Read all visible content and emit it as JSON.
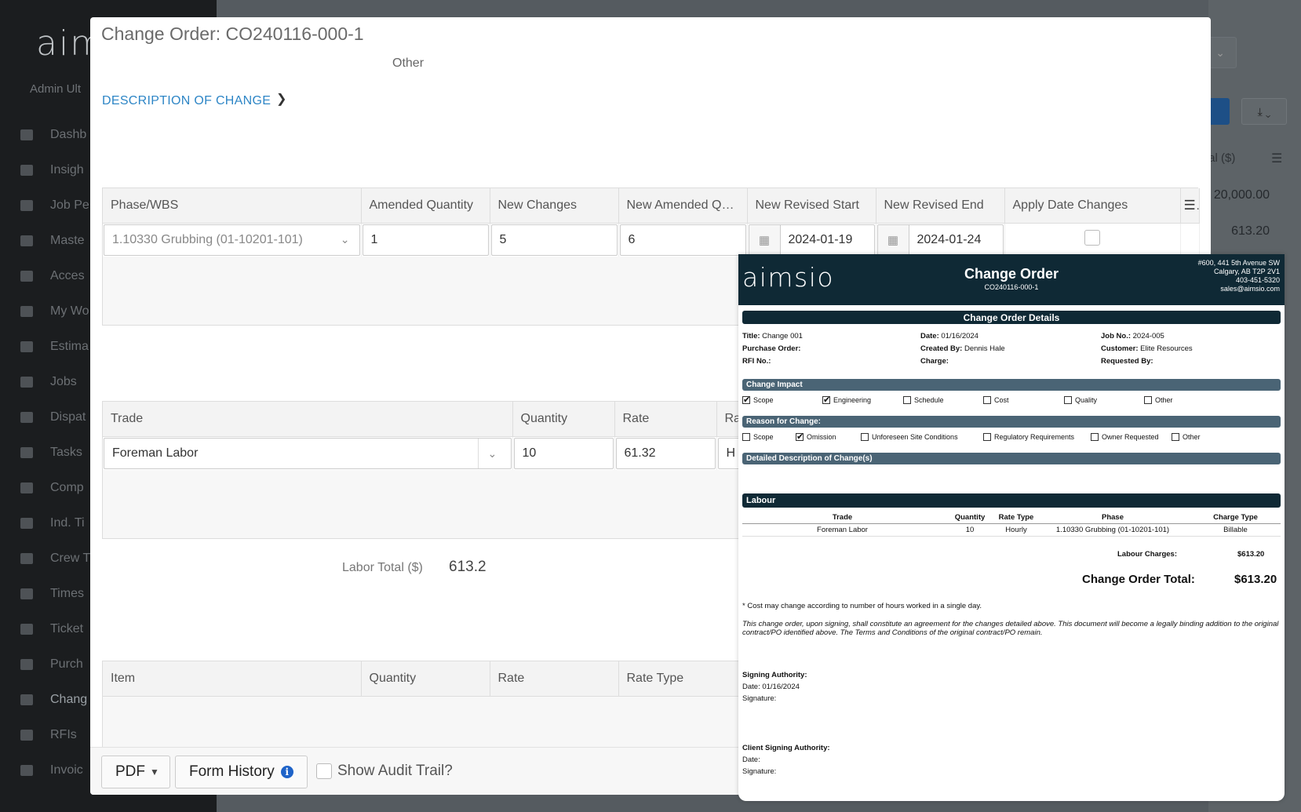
{
  "sidebar": {
    "logo": "aim",
    "user": "Admin Ult",
    "items": [
      {
        "label": "Dashb",
        "icon": "home-icon"
      },
      {
        "label": "Insigh",
        "icon": "pie-chart-icon"
      },
      {
        "label": "Job Pe",
        "icon": "line-chart-icon"
      },
      {
        "label": "Maste",
        "icon": "gear-icon"
      },
      {
        "label": "Acces",
        "icon": "lock-icon"
      },
      {
        "label": "My Wo",
        "icon": "clock-icon"
      },
      {
        "label": "Estima",
        "icon": "edit-icon"
      },
      {
        "label": "Jobs",
        "icon": "external-link-icon"
      },
      {
        "label": "Dispat",
        "icon": "send-icon"
      },
      {
        "label": "Tasks",
        "icon": "list-icon"
      },
      {
        "label": "Comp",
        "icon": "users-icon"
      },
      {
        "label": "Ind. Ti",
        "icon": "list-icon"
      },
      {
        "label": "Crew T",
        "icon": "file-icon"
      },
      {
        "label": "Times",
        "icon": "copy-icon"
      },
      {
        "label": "Ticket",
        "icon": "tag-icon"
      },
      {
        "label": "Purch",
        "icon": "credit-card-icon"
      },
      {
        "label": "Chang",
        "icon": "edit-icon"
      },
      {
        "label": "RFIs",
        "icon": "edit-icon"
      },
      {
        "label": "Invoic",
        "icon": "list-icon"
      }
    ]
  },
  "background": {
    "header_label": "tal ($)",
    "values": [
      "20,000.00",
      "613.20"
    ]
  },
  "modal": {
    "title": "Change Order: CO240116-000-1",
    "other_label": "Other",
    "description_link": "DESCRIPTION OF CHANGE",
    "phase_table": {
      "headers": [
        "Phase/WBS",
        "Amended Quantity",
        "New Changes",
        "New Amended Qu...",
        "New Revised Start",
        "New Revised End",
        "Apply Date Changes"
      ],
      "row": {
        "phase": "1.10330 Grubbing (01-10201-101)",
        "amended_quantity": "1",
        "new_changes": "5",
        "new_amended_quantity": "6",
        "new_revised_start": "2024-01-19",
        "new_revised_end": "2024-01-24"
      }
    },
    "labor_table": {
      "headers": [
        "Trade",
        "Quantity",
        "Rate",
        "Ra"
      ],
      "row": {
        "trade": "Foreman Labor",
        "quantity": "10",
        "rate": "61.32",
        "rate_type": "H"
      }
    },
    "labor_total_label": "Labor Total ($)",
    "labor_total_value": "613.2",
    "item_table": {
      "headers": [
        "Item",
        "Quantity",
        "Rate",
        "Rate Type"
      ]
    },
    "footer": {
      "pdf_label": "PDF",
      "form_history_label": "Form History",
      "audit_label": "Show Audit Trail?"
    }
  },
  "pdf": {
    "logo": "aimsio",
    "title": "Change Order",
    "number": "CO240116-000-1",
    "address": [
      "#600, 441 5th Avenue SW",
      "Calgary, AB T2P 2V1",
      "403-451-5320",
      "sales@aimsio.com"
    ],
    "details_header": "Change Order Details",
    "details": {
      "title_label": "Title:",
      "title": "Change 001",
      "date_label": "Date:",
      "date": "01/16/2024",
      "job_label": "Job No.:",
      "job": "2024-005",
      "po_label": "Purchase Order:",
      "po": "",
      "created_label": "Created By:",
      "created": "Dennis Hale",
      "customer_label": "Customer:",
      "customer": "Elite Resources",
      "rfi_label": "RFI No.:",
      "rfi": "",
      "charge_label": "Charge:",
      "charge": "",
      "requested_label": "Requested By:",
      "requested": ""
    },
    "impact_header": "Change Impact",
    "impact": [
      {
        "label": "Scope",
        "checked": true
      },
      {
        "label": "Engineering",
        "checked": true
      },
      {
        "label": "Schedule",
        "checked": false
      },
      {
        "label": "Cost",
        "checked": false
      },
      {
        "label": "Quality",
        "checked": false
      },
      {
        "label": "Other",
        "checked": false
      }
    ],
    "reason_header": "Reason for Change:",
    "reasons": [
      {
        "label": "Scope",
        "checked": false
      },
      {
        "label": "Omission",
        "checked": true
      },
      {
        "label": "Unforeseen Site Conditions",
        "checked": false
      },
      {
        "label": "Regulatory Requirements",
        "checked": false
      },
      {
        "label": "Owner Requested",
        "checked": false
      },
      {
        "label": "Other",
        "checked": false
      }
    ],
    "detailed_header": "Detailed Description of Change(s)",
    "labour_header": "Labour",
    "labour_columns": [
      "Trade",
      "Quantity",
      "Rate Type",
      "Phase",
      "Charge Type"
    ],
    "labour_row": {
      "trade": "Foreman Labor",
      "quantity": "10",
      "rate_type": "Hourly",
      "phase": "1.10330 Grubbing (01-10201-101)",
      "charge_type": "Billable"
    },
    "labour_charges_label": "Labour Charges:",
    "labour_charges": "$613.20",
    "total_label": "Change Order Total:",
    "total": "$613.20",
    "cost_note": "* Cost may change according to number of hours worked in a single day.",
    "legal": "This change order, upon signing, shall constitute an agreement for the changes detailed above. This document will become a legally binding addition to the original contract/PO identified above. The Terms and Conditions of the original contract/PO remain.",
    "signing_authority": "Signing Authority:",
    "signing_date": "Date: 01/16/2024",
    "signing_signature": "Signature:",
    "client_authority": "Client Signing Authority:",
    "client_date": "Date:",
    "client_signature": "Signature:"
  }
}
